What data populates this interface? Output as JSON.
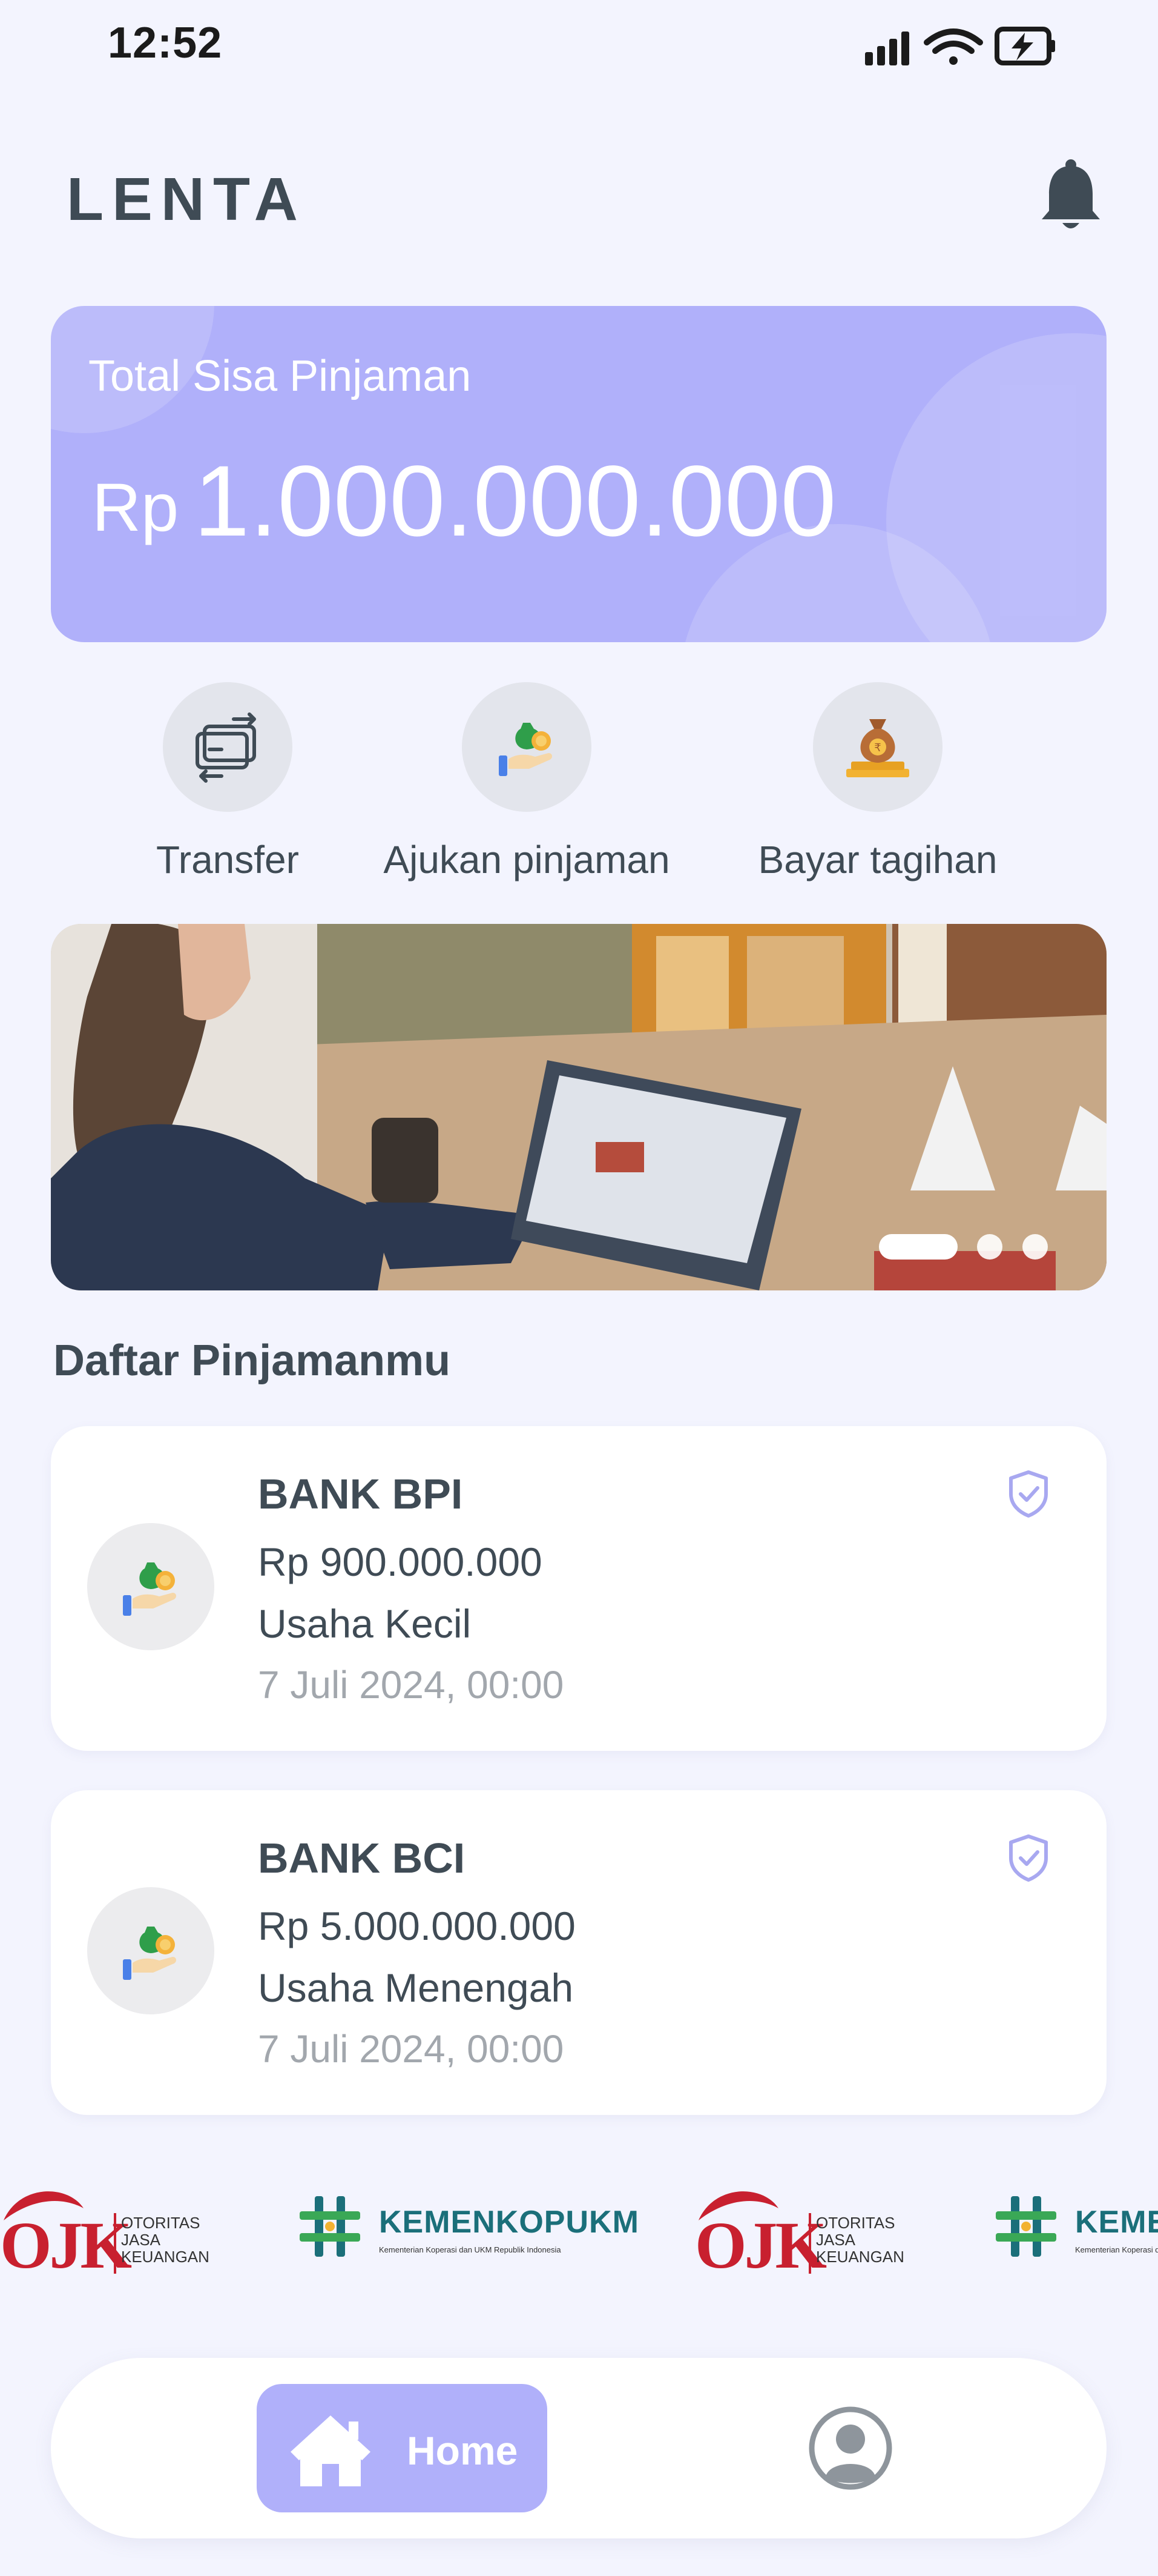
{
  "status_bar": {
    "time": "12:52",
    "signal_icon": "signal-icon",
    "wifi_icon": "wifi-icon",
    "battery_icon": "battery-charging-icon"
  },
  "header": {
    "brand": "LENTA",
    "notification_icon": "bell-icon"
  },
  "balance": {
    "label": "Total Sisa Pinjaman",
    "currency": "Rp",
    "amount": "1.000.000.000"
  },
  "actions": [
    {
      "label": "Transfer",
      "icon": "transfer-icon"
    },
    {
      "label": "Ajukan pinjaman",
      "icon": "loan-hand-icon"
    },
    {
      "label": "Bayar tagihan",
      "icon": "money-bag-icon"
    }
  ],
  "banner": {
    "slides": 3,
    "active_slide": 1
  },
  "loans": {
    "title": "Daftar Pinjamanmu",
    "items": [
      {
        "bank": "BANK BPI",
        "amount": "Rp 900.000.000",
        "type": "Usaha Kecil",
        "date": "7 Juli 2024, 00:00",
        "icon": "verified-shield-icon"
      },
      {
        "bank": "BANK BCI",
        "amount": "Rp 5.000.000.000",
        "type": "Usaha Menengah",
        "date": "7 Juli 2024, 00:00",
        "icon": "verified-shield-icon"
      }
    ]
  },
  "partners": {
    "ojk": {
      "word": "OJK",
      "lines": [
        "OTORITAS",
        "JASA",
        "KEUANGAN"
      ]
    },
    "kemenkop": {
      "name": "KEMENKOP",
      "name2": "UKM",
      "sub": "Kementerian Koperasi dan UKM Republik Indonesia"
    }
  },
  "nav": {
    "home_label": "Home",
    "home_icon": "home-icon",
    "profile_icon": "user-profile-icon"
  },
  "colors": {
    "background": "#f3f4fe",
    "accent": "#b0b0fa",
    "text": "#3f4b55",
    "muted": "#a2a7ad",
    "ojk_red": "#c8202f",
    "kemenkop_teal": "#1b6f7a"
  }
}
